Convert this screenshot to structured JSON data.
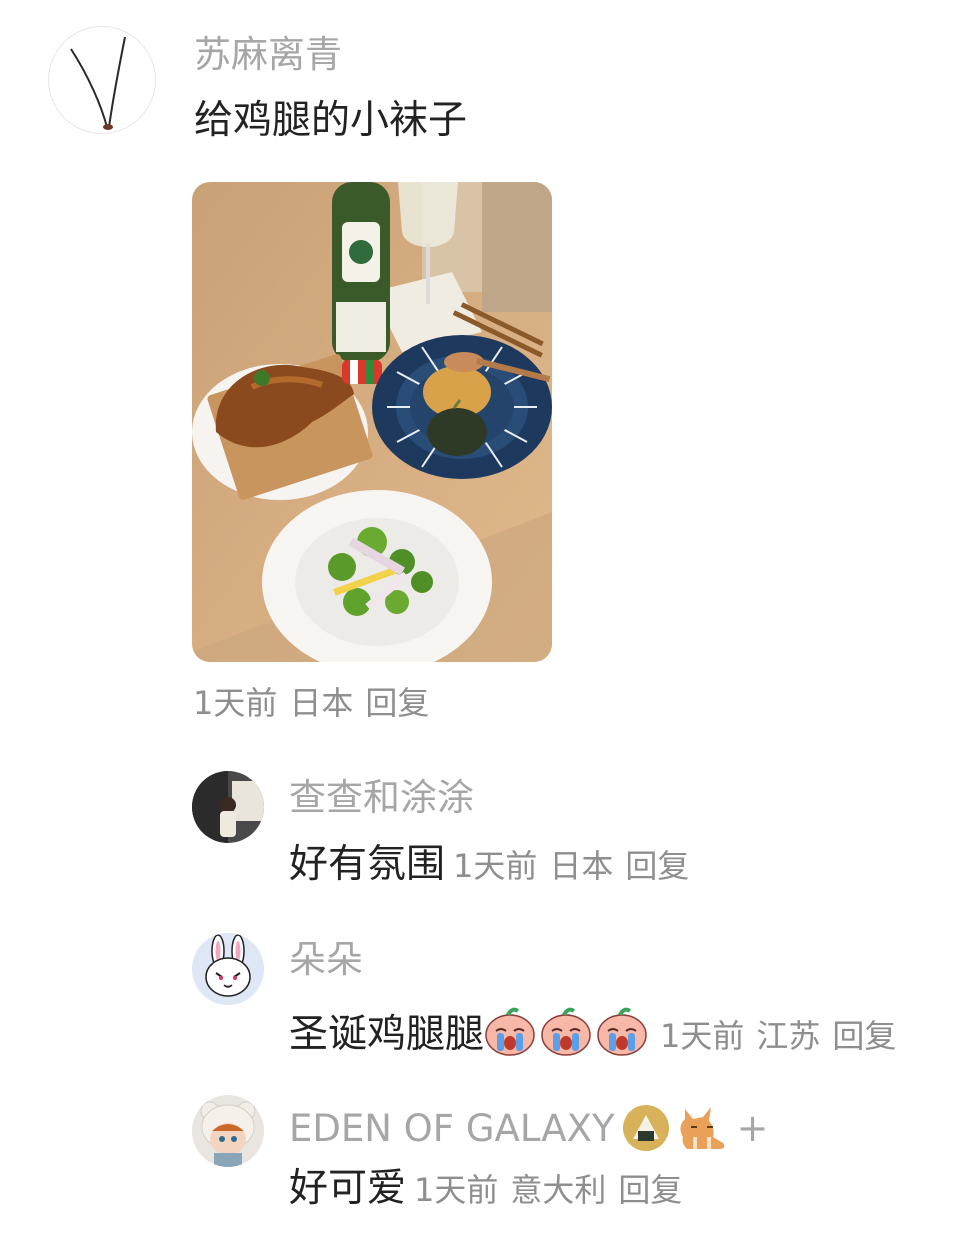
{
  "comment": {
    "username": "苏麻离青",
    "text": "给鸡腿的小袜子",
    "time": "1天前",
    "location": "日本",
    "reply_label": "回复"
  },
  "replies": [
    {
      "username": "查查和涂涂",
      "text": "好有氛围",
      "time": "1天前",
      "location": "日本",
      "reply_label": "回复"
    },
    {
      "username": "朵朵",
      "text": "圣诞鸡腿腿",
      "time": "1天前",
      "location": "江苏",
      "reply_label": "回复"
    },
    {
      "username": "EDEN OF GALAXY",
      "username_suffix": "+",
      "text": "好可爱",
      "time": "1天前",
      "location": "意大利",
      "reply_label": "回复"
    }
  ]
}
